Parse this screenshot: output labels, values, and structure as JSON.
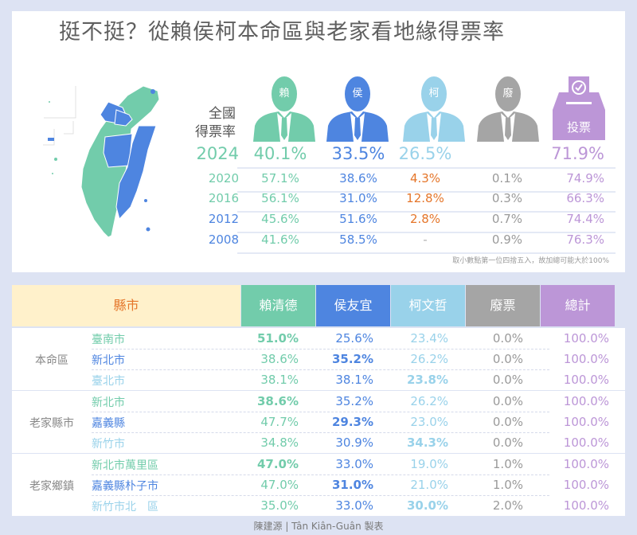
{
  "title": "挺不挺？從賴侯柯本命區與老家看地緣得票率",
  "national": {
    "label_line1": "全國",
    "label_line2": "得票率",
    "candidates": [
      {
        "short": "賴",
        "color": "#72ccab"
      },
      {
        "short": "侯",
        "color": "#4e85e0"
      },
      {
        "short": "柯",
        "color": "#99d2ea"
      },
      {
        "short": "廢",
        "color": "#a5a5a5"
      }
    ],
    "ballot": {
      "label": "投票",
      "color": "#bc96d7"
    },
    "rows": [
      {
        "year": "2024",
        "lai": "40.1%",
        "hou": "33.5%",
        "ko": "26.5%",
        "void": "",
        "turnout": "71.9%",
        "year_color": "#72ccab",
        "ko_color": "#99d2ea"
      },
      {
        "year": "2020",
        "lai": "57.1%",
        "hou": "38.6%",
        "ko": "4.3%",
        "void": "0.1%",
        "turnout": "74.9%",
        "year_color": "#72ccab",
        "ko_color": "#e5762a"
      },
      {
        "year": "2016",
        "lai": "56.1%",
        "hou": "31.0%",
        "ko": "12.8%",
        "void": "0.3%",
        "turnout": "66.3%",
        "year_color": "#72ccab",
        "ko_color": "#e5762a"
      },
      {
        "year": "2012",
        "lai": "45.6%",
        "hou": "51.6%",
        "ko": "2.8%",
        "void": "0.7%",
        "turnout": "74.4%",
        "year_color": "#4e85e0",
        "ko_color": "#e5762a"
      },
      {
        "year": "2008",
        "lai": "41.6%",
        "hou": "58.5%",
        "ko": "-",
        "void": "0.9%",
        "turnout": "76.3%",
        "year_color": "#4e85e0",
        "ko_color": "#b0b0b0"
      }
    ],
    "note": "取小數點第一位四捨五入，故加總可能大於100%"
  },
  "table": {
    "headers": {
      "county": "縣市",
      "lai": "賴清德",
      "hou": "侯友宜",
      "ko": "柯文哲",
      "void": "廢票",
      "total": "總計"
    },
    "groups": [
      {
        "label": "本命區",
        "rows": [
          {
            "name": "臺南市",
            "name_color": "#72ccab",
            "lai": "51.0%",
            "hou": "25.6%",
            "ko": "23.4%",
            "void": "0.0%",
            "total": "100.0%",
            "bold": "lai"
          },
          {
            "name": "新北市",
            "name_color": "#4e85e0",
            "lai": "38.6%",
            "hou": "35.2%",
            "ko": "26.2%",
            "void": "0.0%",
            "total": "100.0%",
            "bold": "hou"
          },
          {
            "name": "臺北市",
            "name_color": "#99d2ea",
            "lai": "38.1%",
            "hou": "38.1%",
            "ko": "23.8%",
            "void": "0.0%",
            "total": "100.0%",
            "bold": "ko"
          }
        ]
      },
      {
        "label": "老家縣市",
        "rows": [
          {
            "name": "新北市",
            "name_color": "#72ccab",
            "lai": "38.6%",
            "hou": "35.2%",
            "ko": "26.2%",
            "void": "0.0%",
            "total": "100.0%",
            "bold": "lai"
          },
          {
            "name": "嘉義縣",
            "name_color": "#4e85e0",
            "lai": "47.7%",
            "hou": "29.3%",
            "ko": "23.0%",
            "void": "0.0%",
            "total": "100.0%",
            "bold": "hou"
          },
          {
            "name": "新竹市",
            "name_color": "#99d2ea",
            "lai": "34.8%",
            "hou": "30.9%",
            "ko": "34.3%",
            "void": "0.0%",
            "total": "100.0%",
            "bold": "ko"
          }
        ]
      },
      {
        "label": "老家鄉鎮",
        "rows": [
          {
            "name": "新北市萬里區",
            "name_color": "#72ccab",
            "lai": "47.0%",
            "hou": "33.0%",
            "ko": "19.0%",
            "void": "1.0%",
            "total": "100.0%",
            "bold": "lai"
          },
          {
            "name": "嘉義縣朴子市",
            "name_color": "#4e85e0",
            "lai": "47.0%",
            "hou": "31.0%",
            "ko": "21.0%",
            "void": "1.0%",
            "total": "100.0%",
            "bold": "hou"
          },
          {
            "name": "新竹市北　區",
            "name_color": "#99d2ea",
            "lai": "35.0%",
            "hou": "33.0%",
            "ko": "30.0%",
            "void": "2.0%",
            "total": "100.0%",
            "bold": "ko"
          }
        ]
      }
    ]
  },
  "credit": "陳建源 | Tân Kiân-Guân 製表",
  "colors": {
    "lai": "#72ccab",
    "hou": "#4e85e0",
    "ko": "#99d2ea",
    "void": "#a5a5a5",
    "turnout": "#bc96d7",
    "highlight_orange": "#e5762a"
  }
}
